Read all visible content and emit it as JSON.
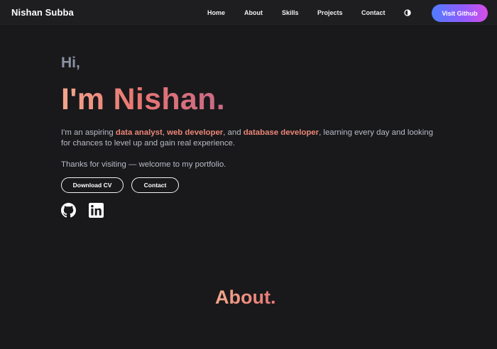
{
  "navbar": {
    "brand": "Nishan Subba",
    "links": [
      "Home",
      "About",
      "Skills",
      "Projects",
      "Contact"
    ],
    "theme_icon": "half-circle-contrast-icon",
    "github_button": "Visit Github"
  },
  "hero": {
    "greeting": "Hi,",
    "title": "I'm Nishan.",
    "intro": {
      "p1": "I'm an aspiring ",
      "role1": "data analyst",
      "sep1": ", ",
      "role2": "web developer",
      "sep2": ", and ",
      "role3": "database developer",
      "p2": ", learning every day and looking for chances to level up and gain real experience."
    },
    "thanks": "Thanks for visiting — welcome to my portfolio.",
    "buttons": {
      "download": "Download CV",
      "contact": "Contact"
    },
    "socials": [
      "github-icon",
      "linkedin-icon"
    ]
  },
  "about": {
    "title": "About."
  },
  "colors": {
    "background": "#19191b",
    "navbar": "#1e1e20",
    "accent": "#ec8577",
    "button_gradient": [
      "#4f7dff",
      "#d64ee6"
    ]
  }
}
